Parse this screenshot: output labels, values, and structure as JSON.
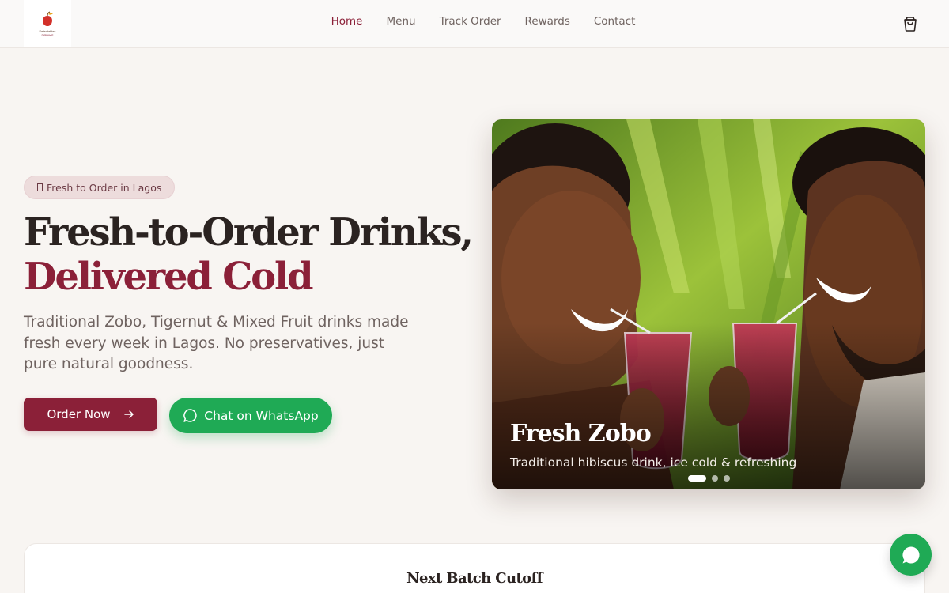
{
  "header": {
    "logo_text_1": "Delectables",
    "logo_text_2": "DRINKS",
    "nav": [
      {
        "label": "Home"
      },
      {
        "label": "Menu"
      },
      {
        "label": "Track Order"
      },
      {
        "label": "Rewards"
      },
      {
        "label": "Contact"
      }
    ],
    "active_nav": "Home",
    "cart_icon": "shopping-bag-icon"
  },
  "hero": {
    "badge": "Fresh to Order in Lagos",
    "title_line1": "Fresh-to-Order Drinks,",
    "title_line2": "Delivered Cold",
    "subtitle": "Traditional Zobo, Tigernut & Mixed Fruit drinks made fresh every week in Lagos. No preservatives, just pure natural goodness.",
    "order_button": "Order Now",
    "whatsapp_button": "Chat on WhatsApp"
  },
  "slider": {
    "title": "Fresh Zobo",
    "description": "Traditional hibiscus drink, ice cold & refreshing",
    "slide_count": 3,
    "active_index": 0
  },
  "cutoff": {
    "title": "Next Batch Cutoff"
  },
  "colors": {
    "brand": "#8b2038",
    "whatsapp": "#1faa55",
    "background": "#f8f5f2"
  }
}
